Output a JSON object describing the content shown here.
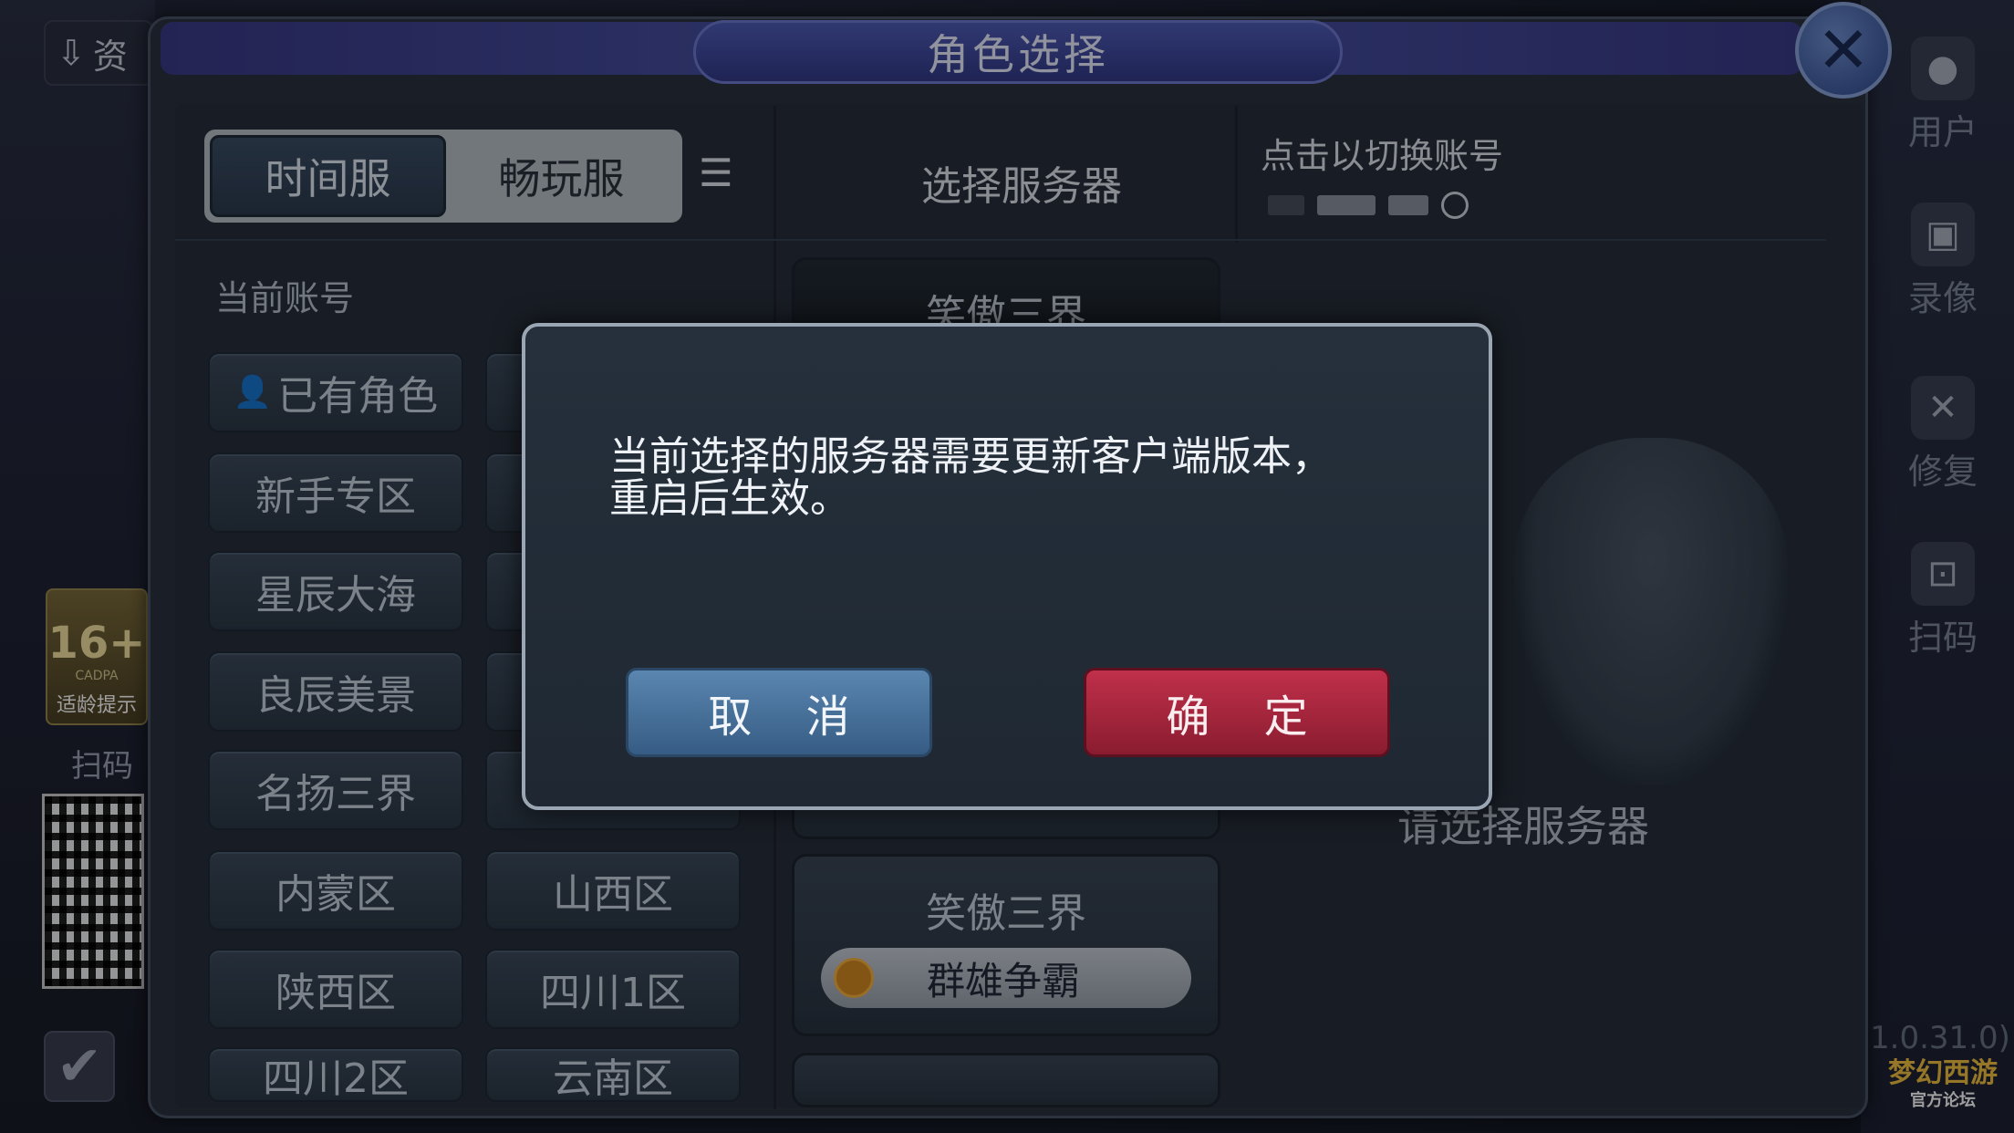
{
  "background": {
    "resource_label": "资",
    "age_badge": {
      "rating": "16+",
      "org": "CADPA",
      "label": "适龄提示"
    },
    "left_scan_label": "扫码",
    "side_menu": [
      {
        "label": "用户",
        "icon": "user-icon"
      },
      {
        "label": "录像",
        "icon": "video-icon"
      },
      {
        "label": "修复",
        "icon": "wrench-icon"
      },
      {
        "label": "扫码",
        "icon": "scan-icon"
      }
    ],
    "version": "1.0.31.0)",
    "logo": {
      "text": "梦幻西游",
      "subtitle": "官方论坛"
    }
  },
  "panel": {
    "title": "角色选择",
    "close_icon": "close-icon",
    "tabs": [
      {
        "label": "时间服",
        "active": true
      },
      {
        "label": "畅玩服",
        "active": false
      }
    ],
    "list_icon": "list-icon",
    "server_column_header": "选择服务器",
    "switch_account": "点击以切换账号",
    "current_account_label": "当前账号",
    "zones_left": [
      "已有角色",
      "新手专区",
      "星辰大海",
      "良辰美景",
      "名扬三界",
      "内蒙区",
      "陕西区",
      "四川2区"
    ],
    "zones_right": [
      "山西区",
      "四川1区",
      "云南区"
    ],
    "server_top": "笑傲三界",
    "server_card": {
      "title": "笑傲三界",
      "server": "群雄争霸"
    },
    "select_hint": "请选择服务器"
  },
  "modal": {
    "line1": "当前选择的服务器需要更新客户端版本，",
    "line2": "重启后生效。",
    "cancel": "取 消",
    "confirm": "确 定"
  }
}
